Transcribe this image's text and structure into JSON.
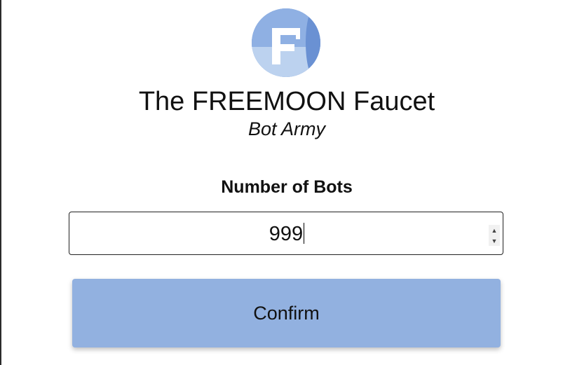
{
  "header": {
    "logo_icon": "freemoon-logo-icon",
    "title": "The FREEMOON Faucet",
    "subtitle": "Bot Army"
  },
  "form": {
    "label": "Number of Bots",
    "value": "999",
    "spin_up_icon": "spin-up-icon",
    "spin_down_icon": "spin-down-icon",
    "confirm_label": "Confirm"
  },
  "colors": {
    "button": "#92b1e0",
    "logo_light": "#bcd2ef",
    "logo_mid": "#8fb0e3",
    "logo_dark": "#6a91d3",
    "text": "#111111"
  }
}
